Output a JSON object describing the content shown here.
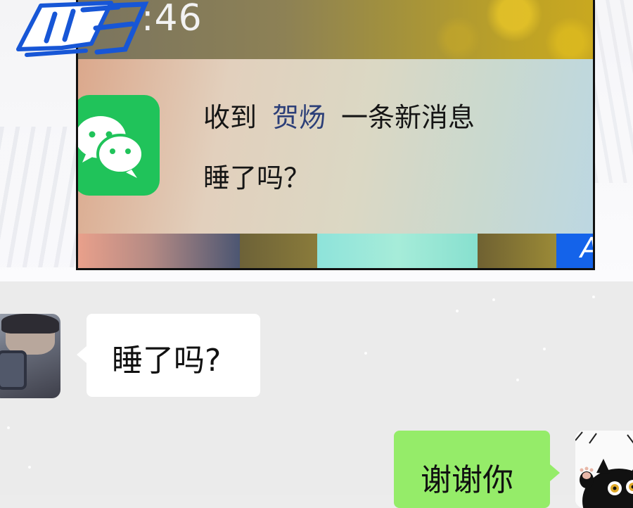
{
  "status_bar": {
    "time": ":46"
  },
  "notification": {
    "app_icon": "wechat-icon",
    "title_prefix": "收到",
    "sender": "贺炀",
    "title_suffix": "一条新消息",
    "preview": "睡了吗？"
  },
  "chat": {
    "incoming": {
      "text": "睡了吗?",
      "avatar": "avatar-man-with-phone"
    },
    "outgoing": {
      "text": "谢谢你",
      "avatar": "avatar-black-cat"
    }
  },
  "colors": {
    "wechat_green": "#20c35a",
    "sender_blue": "#2c3f78",
    "outgoing_bubble": "#95ec69",
    "incoming_bubble": "#ffffff",
    "chat_background": "#ebebeb"
  }
}
